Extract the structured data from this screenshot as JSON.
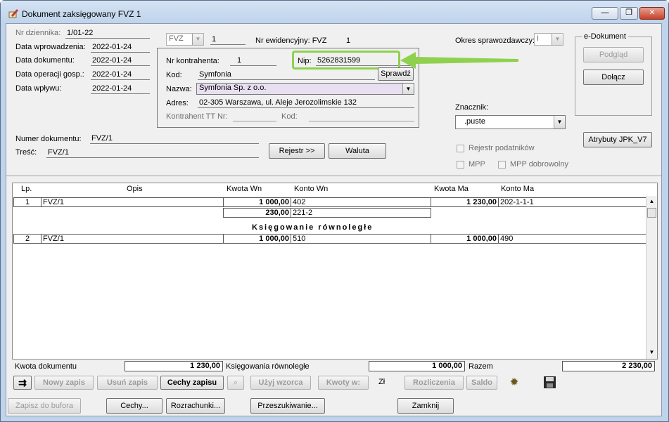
{
  "window": {
    "title": "Dokument zaksięgowany FVZ 1",
    "min": "—",
    "max": "❐",
    "close": "✕"
  },
  "header": {
    "nr_dziennika_label": "Nr dziennika:",
    "nr_dziennika": "1/01-22",
    "data_wprowadzenia_label": "Data wprowadzenia:",
    "data_wprowadzenia": "2022-01-24",
    "data_dokumentu_label": "Data dokumentu:",
    "data_dokumentu": "2022-01-24",
    "data_operacji_label": "Data operacji gosp.:",
    "data_operacji": "2022-01-24",
    "data_wplywu_label": "Data wpływu:",
    "data_wplywu": "2022-01-24",
    "typ": "FVZ",
    "typ_nr": "1",
    "nr_ewid_label": "Nr ewidencyjny: FVZ",
    "nr_ewid": "1",
    "okres_label": "Okres sprawozdawczy:",
    "okres": "I"
  },
  "kontrahent": {
    "nr_label": "Nr kontrahenta:",
    "nr": "1",
    "nip_label": "Nip:",
    "nip": "5262831599",
    "kod_label": "Kod:",
    "kod": "Symfonia",
    "sprawdz": "Sprawdź",
    "nazwa_label": "Nazwa:",
    "nazwa": "Symfonia Sp. z o.o.",
    "adres_label": "Adres:",
    "adres": "02-305 Warszawa, ul. Aleje Jerozolimskie 132",
    "tt_label": "Kontrahent TT Nr:",
    "kod2_label": "Kod:"
  },
  "edok": {
    "title": "e-Dokument",
    "podglad": "Podgląd",
    "dolacz": "Dołącz"
  },
  "znacznik": {
    "label": "Znacznik:",
    "value": ".puste"
  },
  "atrybuty": "Atrybuty JPK_V7",
  "checks": {
    "rejestr": "Rejestr podatników",
    "mpp": "MPP",
    "mpp_dobr": "MPP dobrowolny"
  },
  "numer": {
    "label": "Numer dokumentu:",
    "value": "FVZ/1",
    "tresc_label": "Treść:",
    "tresc": "FVZ/1"
  },
  "buttons": {
    "rejestr": "Rejestr >>",
    "waluta": "Waluta"
  },
  "grid": {
    "headers": {
      "lp": "Lp.",
      "opis": "Opis",
      "kwota_wn": "Kwota  Wn",
      "konto_wn": "Konto  Wn",
      "kwota_ma": "Kwota Ma",
      "konto_ma": "Konto Ma"
    },
    "rows": [
      {
        "lp": "1",
        "opis": "FVZ/1",
        "kwota_wn": "1 000,00",
        "konto_wn": "402",
        "kwota_ma": "1 230,00",
        "konto_ma": "202-1-1-1"
      },
      {
        "kwota_wn": "230,00",
        "konto_wn": "221-2"
      },
      {
        "lp": "2",
        "opis": "FVZ/1",
        "kwota_wn": "1 000,00",
        "konto_wn": "510",
        "kwota_ma": "1 000,00",
        "konto_ma": "490"
      }
    ],
    "section": "Księgowanie równoległe"
  },
  "totals": {
    "kwota_label": "Kwota dokumentu",
    "kwota": "1 230,00",
    "rown_label": "Księgowania równoległe",
    "rown": "1 000,00",
    "razem_label": "Razem",
    "razem": "2 230,00"
  },
  "toolbar": {
    "nowy": "Nowy zapis",
    "usun": "Usuń zapis",
    "cechy": "Cechy zapisu",
    "wzorca": "Użyj wzorca",
    "kwoty": "Kwoty w:",
    "zl": "Zł",
    "rozl": "Rozliczenia",
    "saldo": "Saldo"
  },
  "bottom": {
    "zapisz": "Zapisz do bufora",
    "cechy": "Cechy...",
    "rozrach": "Rozrachunki...",
    "przesz": "Przeszukiwanie...",
    "zamknij": "Zamknij"
  },
  "colors": {
    "highlight": "#8fd14f",
    "arrow": "#8fd14f"
  }
}
